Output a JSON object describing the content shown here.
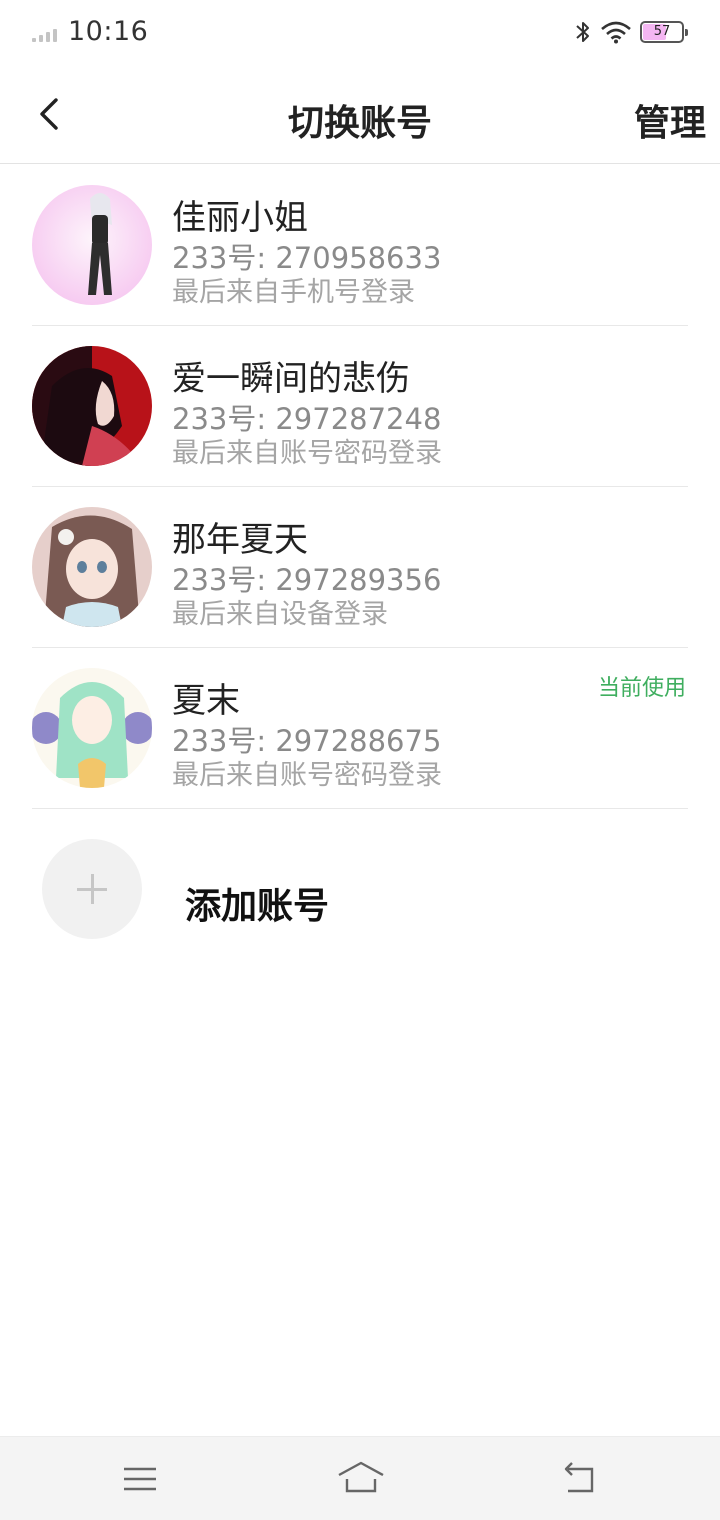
{
  "status": {
    "time": "10:16",
    "battery": "57",
    "battery_level": 0.57
  },
  "header": {
    "title": "切换账号",
    "action": "管理",
    "back_icon": "chevron-left-icon"
  },
  "accounts": [
    {
      "name": "佳丽小姐",
      "id": "233号: 270958633",
      "source": "最后来自手机号登录",
      "badge": ""
    },
    {
      "name": "爱一瞬间的悲伤",
      "id": "233号: 297287248",
      "source": "最后来自账号密码登录",
      "badge": ""
    },
    {
      "name": "那年夏天",
      "id": "233号: 297289356",
      "source": "最后来自设备登录",
      "badge": ""
    },
    {
      "name": "夏末",
      "id": "233号: 297288675",
      "source": "最后来自账号密码登录",
      "badge": "当前使用"
    }
  ],
  "add_account": {
    "label": "添加账号",
    "icon": "plus-icon"
  },
  "colors": {
    "accent_green": "#3fae5f",
    "battery_fill": "#f4b6f2"
  },
  "system_nav": {
    "icons": [
      "menu-icon",
      "home-icon",
      "back-icon"
    ]
  }
}
